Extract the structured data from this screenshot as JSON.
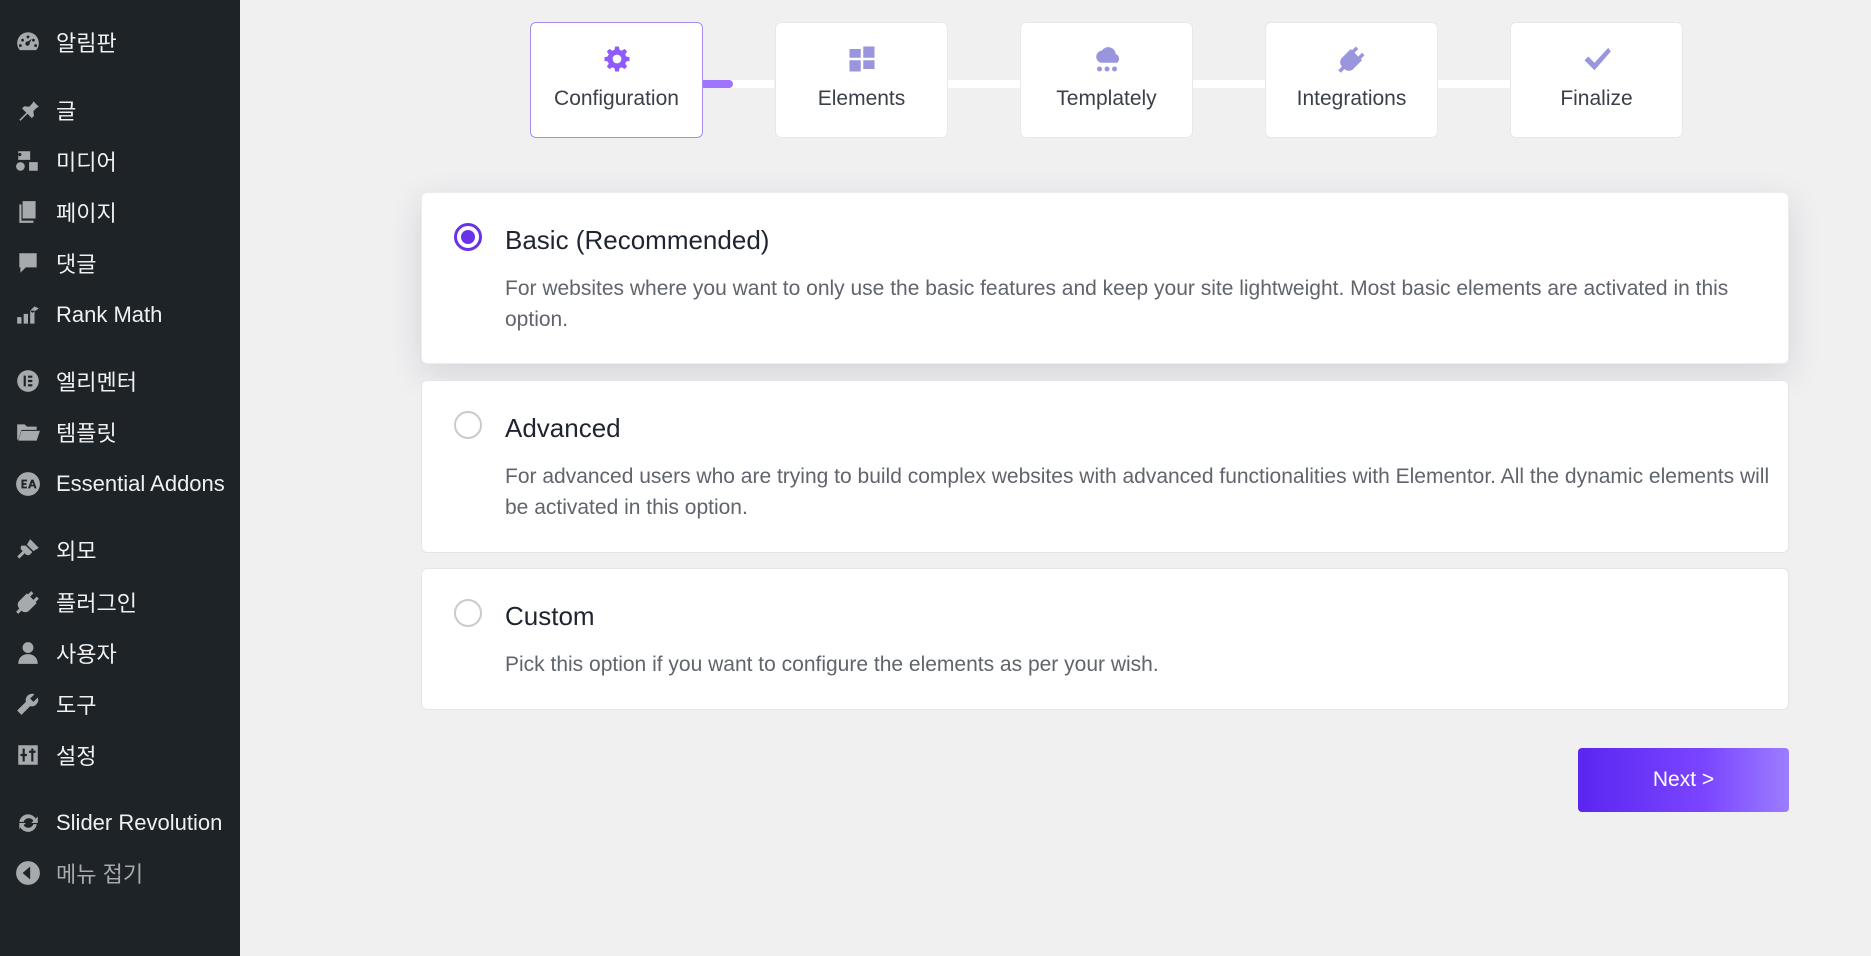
{
  "sidebar": {
    "items": [
      {
        "label": "알림판",
        "icon": "dashboard-icon"
      },
      {
        "label": "글",
        "icon": "pushpin-icon"
      },
      {
        "label": "미디어",
        "icon": "media-icon"
      },
      {
        "label": "페이지",
        "icon": "pages-icon"
      },
      {
        "label": "댓글",
        "icon": "comment-icon"
      },
      {
        "label": "Rank Math",
        "icon": "rank-math-icon"
      },
      {
        "label": "엘리멘터",
        "icon": "elementor-icon"
      },
      {
        "label": "템플릿",
        "icon": "folder-icon"
      },
      {
        "label": "Essential Addons",
        "icon": "essential-addons-icon"
      },
      {
        "label": "외모",
        "icon": "brush-icon"
      },
      {
        "label": "플러그인",
        "icon": "plugin-icon"
      },
      {
        "label": "사용자",
        "icon": "user-icon"
      },
      {
        "label": "도구",
        "icon": "wrench-icon"
      },
      {
        "label": "설정",
        "icon": "settings-icon"
      },
      {
        "label": "Slider Revolution",
        "icon": "refresh-icon"
      },
      {
        "label": "메뉴 접기",
        "icon": "collapse-icon"
      }
    ]
  },
  "stepper": {
    "steps": [
      {
        "label": "Configuration",
        "icon": "gear-icon",
        "active": true
      },
      {
        "label": "Elements",
        "icon": "grid-icon",
        "active": false
      },
      {
        "label": "Templately",
        "icon": "cloud-icon",
        "active": false
      },
      {
        "label": "Integrations",
        "icon": "plug-icon",
        "active": false
      },
      {
        "label": "Finalize",
        "icon": "checkmark-icon",
        "active": false
      }
    ],
    "progress": 0.45
  },
  "options": [
    {
      "title": "Basic (Recommended)",
      "description": "For websites where you want to only use the basic features and keep your site lightweight. Most basic elements are activated in this option.",
      "selected": true
    },
    {
      "title": "Advanced",
      "description": "For advanced users who are trying to build complex websites with advanced functionalities with Elementor. All the dynamic elements will be activated in this option.",
      "selected": false
    },
    {
      "title": "Custom",
      "description": "Pick this option if you want to configure the elements as per your wish.",
      "selected": false
    }
  ],
  "next_button": {
    "label": "Next >"
  },
  "colors": {
    "sidebar_bg": "#1d2327",
    "accent": "#6a32e8",
    "step_icon": "#9a96dd",
    "page_bg": "#f0f0f1"
  }
}
